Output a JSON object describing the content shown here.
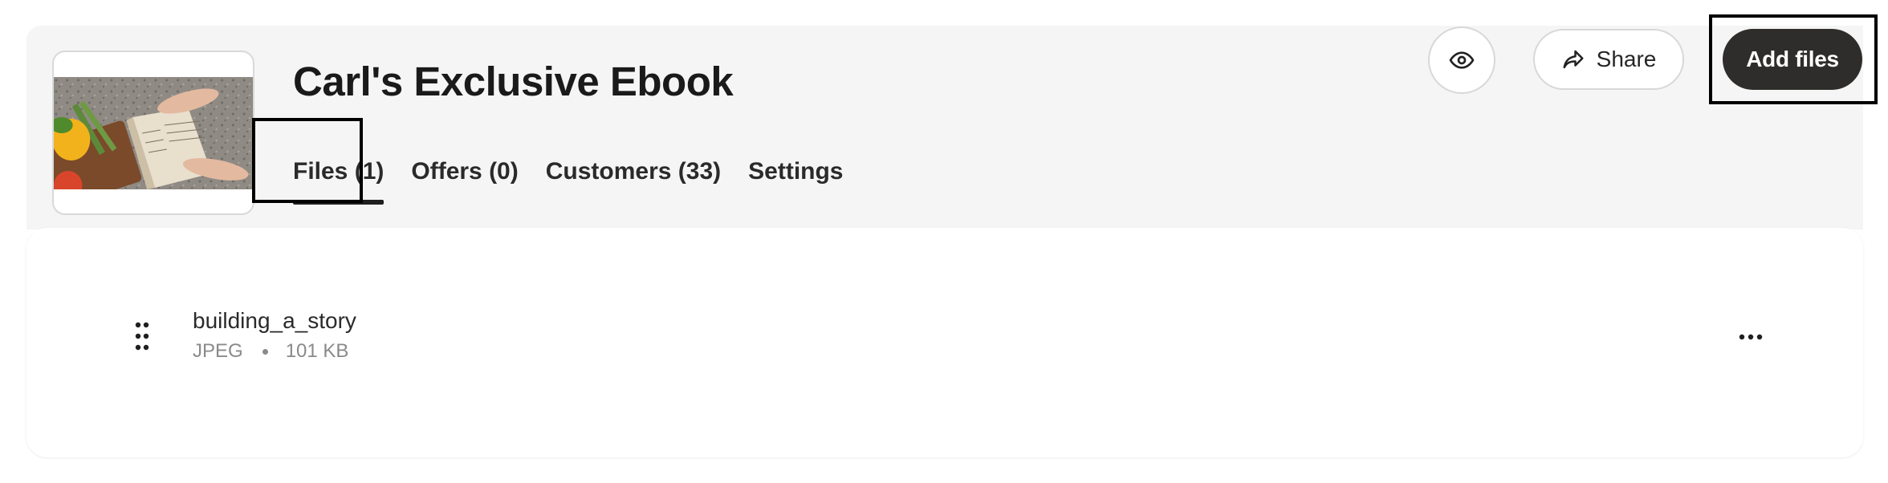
{
  "product": {
    "title": "Carl's Exclusive Ebook",
    "thumbnail_icon": "cover-photo"
  },
  "tabs": [
    {
      "label": "Files (1)",
      "active": true
    },
    {
      "label": "Offers (0)",
      "active": false
    },
    {
      "label": "Customers (33)",
      "active": false
    },
    {
      "label": "Settings",
      "active": false
    }
  ],
  "toolbar": {
    "preview_icon": "eye-icon",
    "share_icon": "share-arrow-icon",
    "share_label": "Share",
    "add_files_label": "Add files"
  },
  "files": [
    {
      "name": "building_a_story",
      "type": "JPEG",
      "size": "101 KB"
    }
  ],
  "colors": {
    "primary_button": "#2e2d2b",
    "header_bg": "#f5f5f5"
  }
}
